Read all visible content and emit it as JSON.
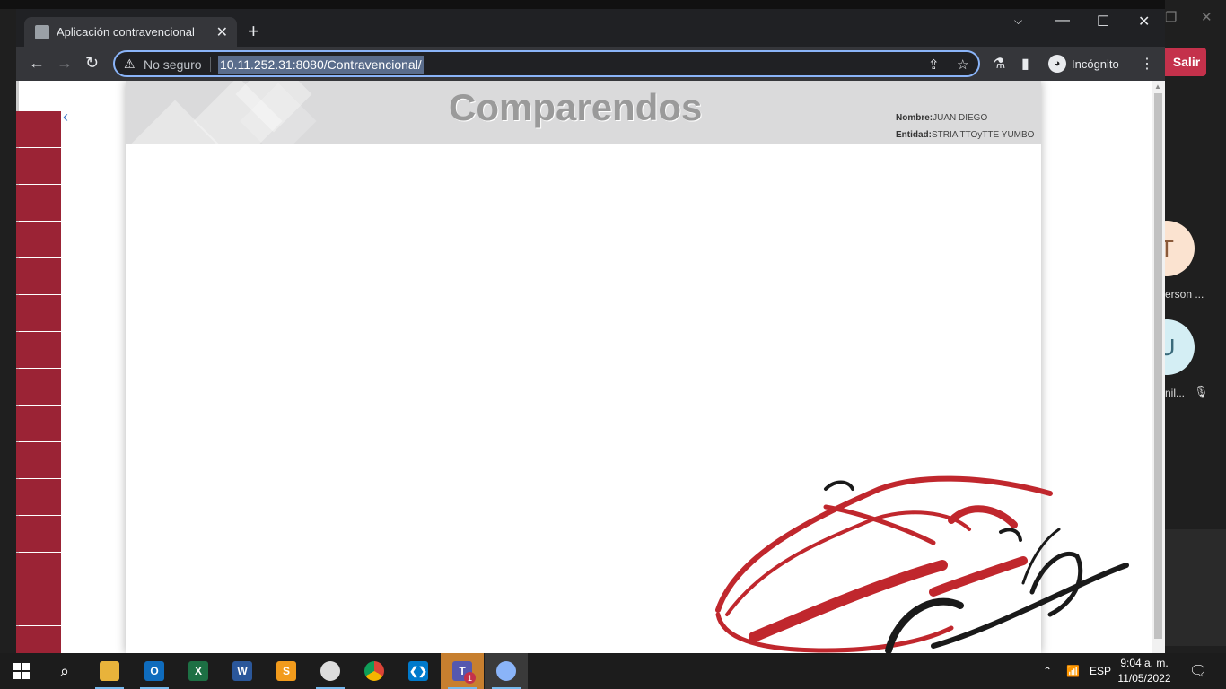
{
  "browser": {
    "tab_title": "Aplicación contravencional",
    "security_label": "No seguro",
    "url": "10.11.252.31:8080/Contravencional/",
    "profile_label": "Incógnito"
  },
  "app": {
    "title": "Comparendos",
    "user_label": "Nombre:",
    "user_value": "JUAN DIEGO",
    "entity_label": "Entidad:",
    "entity_value": "STRIA TTOyTTE YUMBO",
    "sidebar_count": 15
  },
  "background_app": {
    "leave_label": "Salir",
    "participants": [
      {
        "initial": "T",
        "name": "erson ..."
      },
      {
        "initial": "U",
        "name": "nil..."
      }
    ]
  },
  "taskbar": {
    "apps": [
      "start",
      "search",
      "file-explorer",
      "outlook",
      "excel",
      "word",
      "sublime-text",
      "app",
      "chrome",
      "vscode",
      "teams",
      "chrome-incognito"
    ],
    "teams_badge": "1",
    "language": "ESP",
    "time": "9:04 a. m.",
    "date": "11/05/2022"
  },
  "colors": {
    "sidebar_red": "#9b2335",
    "car_red": "#c0272d",
    "salir_red": "#c4314b"
  }
}
